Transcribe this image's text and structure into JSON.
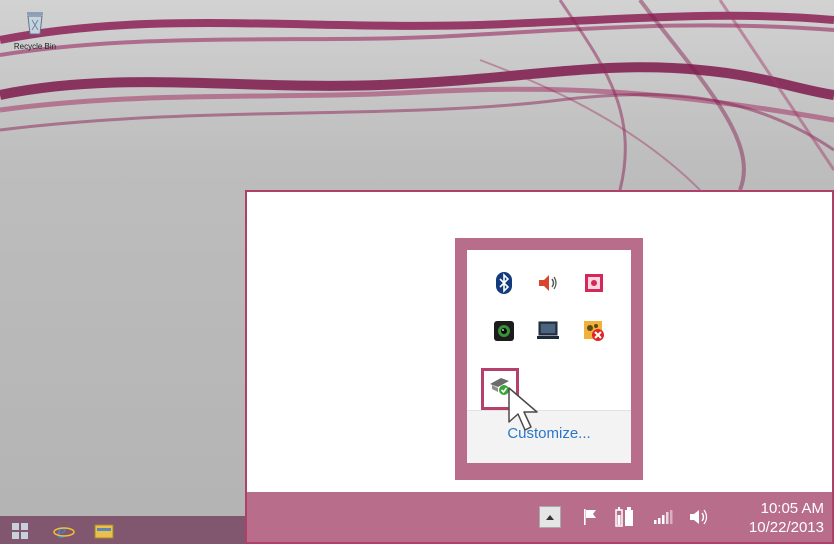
{
  "desktop": {
    "recycle_bin_label": "Recycle Bin",
    "taskbar_items": [
      "start-icon",
      "internet-explorer-icon",
      "file-explorer-icon"
    ]
  },
  "flyout": {
    "icons": [
      {
        "name": "bluetooth-icon"
      },
      {
        "name": "speaker-icon"
      },
      {
        "name": "power-manager-icon"
      },
      {
        "name": "webcam-icon"
      },
      {
        "name": "display-icon"
      },
      {
        "name": "network-error-icon"
      },
      {
        "name": "update-center-icon"
      }
    ],
    "customize_label": "Customize..."
  },
  "taskbar": {
    "icons": [
      "show-hidden-icons-icon",
      "flag-icon",
      "battery-icon",
      "signal-icon",
      "volume-icon"
    ],
    "time": "10:05 AM",
    "date": "10/22/2013"
  },
  "colors": {
    "accent": "#b5406c",
    "taskbar": "#b86e8b",
    "link": "#2a77c9"
  }
}
